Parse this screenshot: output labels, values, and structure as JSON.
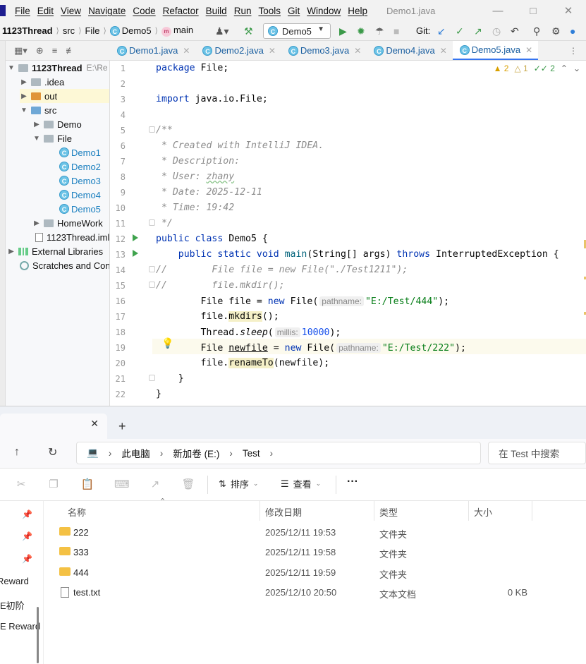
{
  "ide": {
    "menu": [
      "File",
      "Edit",
      "View",
      "Navigate",
      "Code",
      "Refactor",
      "Build",
      "Run",
      "Tools",
      "Git",
      "Window",
      "Help"
    ],
    "window_title": "Demo1.java",
    "breadcrumb": {
      "project": "1123Thread",
      "src": "src",
      "pkg": "File",
      "cls": "Demo5",
      "method": "main"
    },
    "run_config": "Demo5",
    "git_label": "Git:",
    "tabs": [
      {
        "label": "Demo1.java",
        "active": false
      },
      {
        "label": "Demo2.java",
        "active": false
      },
      {
        "label": "Demo3.java",
        "active": false
      },
      {
        "label": "Demo4.java",
        "active": false
      },
      {
        "label": "Demo5.java",
        "active": true
      }
    ],
    "inspections": {
      "warnings": "2",
      "weak": "1",
      "ok": "2"
    },
    "project_root": {
      "name": "1123Thread",
      "path": "E:\\Re"
    },
    "tree": {
      "idea": ".idea",
      "out": "out",
      "src": "src",
      "demo": "Demo",
      "file": "File",
      "classes": [
        "Demo1",
        "Demo2",
        "Demo3",
        "Demo4",
        "Demo5"
      ],
      "homework": "HomeWork",
      "iml": "1123Thread.iml",
      "libs": "External Libraries",
      "scratches": "Scratches and Consoles"
    },
    "line_numbers": [
      "1",
      "2",
      "3",
      "4",
      "5",
      "6",
      "7",
      "8",
      "9",
      "10",
      "11",
      "12",
      "13",
      "14",
      "15",
      "16",
      "17",
      "18",
      "19",
      "20",
      "21",
      "22"
    ],
    "code": {
      "l1_kw": "package",
      "l1_rest": " File;",
      "l3_kw": "import",
      "l3_rest": " java.io.File;",
      "l5": "/**",
      "l6": " * Created with IntelliJ IDEA.",
      "l7": " * Description:",
      "l8a": " * User: ",
      "l8b": "zhany",
      "l9": " * Date: 2025-12-11",
      "l10": " * Time: 19:42",
      "l11": " */",
      "l12_kw": "public class",
      "l12_rest": " Demo5 {",
      "l13_kw1": "    public static void",
      "l13_m": " main",
      "l13_rest": "(String[] args) ",
      "l13_kw2": "throws",
      "l13_rest2": " InterruptedException {",
      "l14": "//        File file = new File(\"./Test1211\");",
      "l15": "//        file.mkdir();",
      "l16_a": "        File file = ",
      "l16_kw": "new",
      "l16_b": " File(",
      "l16_hint": "pathname:",
      "l16_str": "\"E:/Test/444\"",
      "l16_c": ");",
      "l17_a": "        file.",
      "l17_m": "mkdirs",
      "l17_b": "();",
      "l18_a": "        Thread.",
      "l18_m": "sleep",
      "l18_b": "(",
      "l18_hint": "millis:",
      "l18_num": "10000",
      "l18_c": ");",
      "l19_a": "        File ",
      "l19_v": "newfile",
      "l19_b": " = ",
      "l19_kw": "new",
      "l19_c": " File(",
      "l19_hint": "pathname:",
      "l19_str": "\"E:/Test/222\"",
      "l19_d": ");",
      "l20_a": "        file.",
      "l20_m": "renameTo",
      "l20_b": "(newfile);",
      "l21": "    }",
      "l22": "}"
    }
  },
  "explorer": {
    "breadcrumb": [
      "此电脑",
      "新加卷 (E:)",
      "Test"
    ],
    "search_placeholder": "在 Test 中搜索",
    "sort_label": "排序",
    "view_label": "查看",
    "more_label": "···",
    "columns": [
      "名称",
      "修改日期",
      "类型",
      "大小"
    ],
    "files": [
      {
        "name": "222",
        "date": "2025/12/11 19:53",
        "type": "文件夹",
        "size": "",
        "kind": "folder"
      },
      {
        "name": "333",
        "date": "2025/12/11 19:58",
        "type": "文件夹",
        "size": "",
        "kind": "folder"
      },
      {
        "name": "444",
        "date": "2025/12/11 19:59",
        "type": "文件夹",
        "size": "",
        "kind": "folder"
      },
      {
        "name": "test.txt",
        "date": "2025/12/10 20:50",
        "type": "文本文档",
        "size": "0 KB",
        "kind": "file"
      }
    ],
    "nav_items": [
      "Reward",
      "E初阶",
      "E Reward"
    ]
  }
}
